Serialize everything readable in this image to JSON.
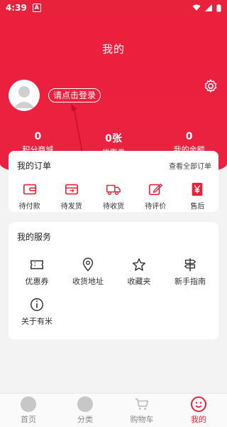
{
  "status": {
    "time": "4:39",
    "app_icon": "A"
  },
  "header": {
    "title": "我的",
    "login_label": "请点击登录"
  },
  "stats": [
    {
      "value": "0",
      "label": "积分商城"
    },
    {
      "value": "0张",
      "label": "优惠券"
    },
    {
      "value": "0",
      "label": "我的余额"
    }
  ],
  "orders": {
    "title": "我的订单",
    "view_all": "查看全部订单",
    "items": [
      {
        "label": "待付款",
        "icon": "wallet-icon"
      },
      {
        "label": "待发货",
        "icon": "package-icon"
      },
      {
        "label": "待收货",
        "icon": "truck-icon"
      },
      {
        "label": "待评价",
        "icon": "edit-icon"
      },
      {
        "label": "售后",
        "icon": "yen-icon"
      }
    ]
  },
  "services": {
    "title": "我的服务",
    "items": [
      {
        "label": "优惠券",
        "icon": "coupon-icon"
      },
      {
        "label": "收货地址",
        "icon": "location-icon"
      },
      {
        "label": "收藏夹",
        "icon": "star-icon"
      },
      {
        "label": "新手指南",
        "icon": "signpost-icon"
      },
      {
        "label": "关于有米",
        "icon": "info-icon"
      }
    ]
  },
  "tabbar": [
    {
      "label": "首页",
      "icon": "home-icon"
    },
    {
      "label": "分类",
      "icon": "category-icon"
    },
    {
      "label": "购物车",
      "icon": "cart-icon"
    },
    {
      "label": "我的",
      "icon": "smile-icon",
      "active": true
    }
  ],
  "colors": {
    "accent": "#e8223a"
  }
}
